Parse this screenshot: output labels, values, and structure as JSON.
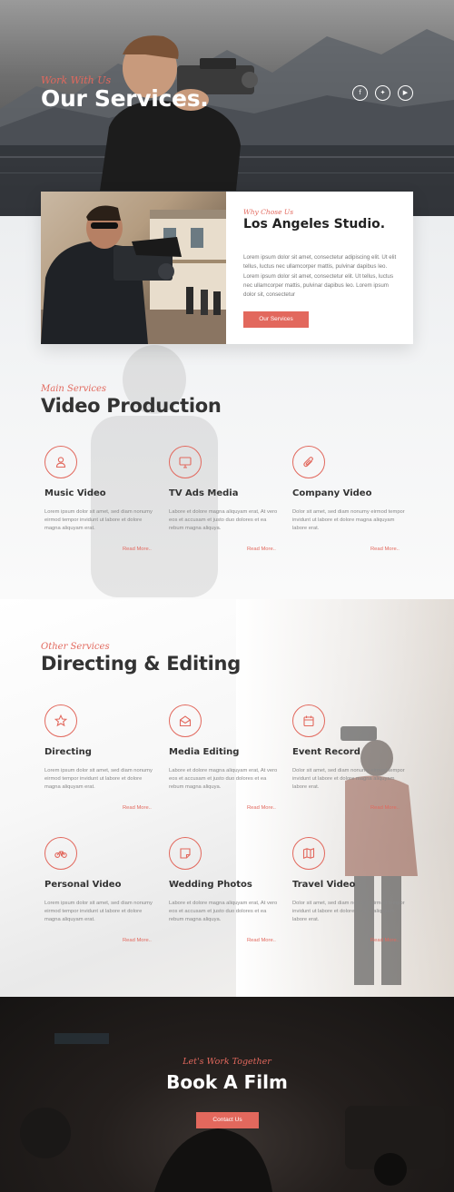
{
  "hero": {
    "subtitle": "Work With Us",
    "title": "Our Services.",
    "social": [
      "facebook-icon",
      "twitter-icon",
      "youtube-icon"
    ]
  },
  "studio": {
    "subtitle": "Why Chose Us",
    "title": "Los Angeles Studio.",
    "text": "Lorem ipsum dolor sit amet, consectetur adipiscing elit. Ut elit tellus, luctus nec ullamcorper mattis, pulvinar dapibus leo. Lorem ipsum dolor sit amet, consectetur elit. Ut tellus, luctus nec ullamcorper mattis, pulvinar dapibus leo. Lorem ipsum dolor sit, consectetur",
    "button": "Our Services"
  },
  "main_services": {
    "subtitle": "Main Services",
    "title": "Video Production",
    "items": [
      {
        "icon": "user-icon",
        "name": "Music Video",
        "desc": "Lorem ipsum dolor sit amet, sed diam nonumy eirmod tempor invidunt ut labore et dolore magna aliquyam erat.",
        "more": "Read More.."
      },
      {
        "icon": "monitor-icon",
        "name": "TV Ads Media",
        "desc": "Labore et dolore magna aliquyam erat, At vero eos et accusam et justo duo dolores et ea rebum magna aliquya.",
        "more": "Read More.."
      },
      {
        "icon": "paperclip-icon",
        "name": "Company Video",
        "desc": "Dolor sit amet, sed diam nonumy eirmod tempor invidunt ut labore et dolore magna aliquyam labore erat.",
        "more": "Read More.."
      }
    ]
  },
  "other_services": {
    "subtitle": "Other Services",
    "title": "Directing & Editing",
    "items": [
      {
        "icon": "star-icon",
        "name": "Directing",
        "desc": "Lorem ipsum dolor sit amet, sed diam nonumy eirmod tempor invidunt ut labore et dolore magna aliquyam erat.",
        "more": "Read More.."
      },
      {
        "icon": "envelope-open-icon",
        "name": "Media Editing",
        "desc": "Labore et dolore magna aliquyam erat, At vero eos et accusam et justo duo dolores et ea rebum magna aliquya.",
        "more": "Read More.."
      },
      {
        "icon": "calendar-icon",
        "name": "Event Record",
        "desc": "Dolor sit amet, sed diam nonumy eirmod tempor invidunt ut labore et dolore magna aliquyam labore erat.",
        "more": "Read More.."
      },
      {
        "icon": "bicycle-icon",
        "name": "Personal Video",
        "desc": "Lorem ipsum dolor sit amet, sed diam nonumy eirmod tempor invidunt ut labore et dolore magna aliquyam erat.",
        "more": "Read More.."
      },
      {
        "icon": "sticky-note-icon",
        "name": "Wedding Photos",
        "desc": "Labore et dolore magna aliquyam erat, At vero eos et accusam et justo duo dolores et ea rebum magna aliquya.",
        "more": "Read More.."
      },
      {
        "icon": "map-icon",
        "name": "Travel Video",
        "desc": "Dolor sit amet, sed diam nonumy eirmod tempor invidunt ut labore et dolore magna aliquyam labore erat.",
        "more": "Read More.."
      }
    ]
  },
  "book": {
    "subtitle": "Let's Work Together",
    "title": "Book A Film",
    "button": "Contact Us"
  },
  "colors": {
    "accent": "#e2685d",
    "heading": "#333333",
    "text": "#888888"
  }
}
